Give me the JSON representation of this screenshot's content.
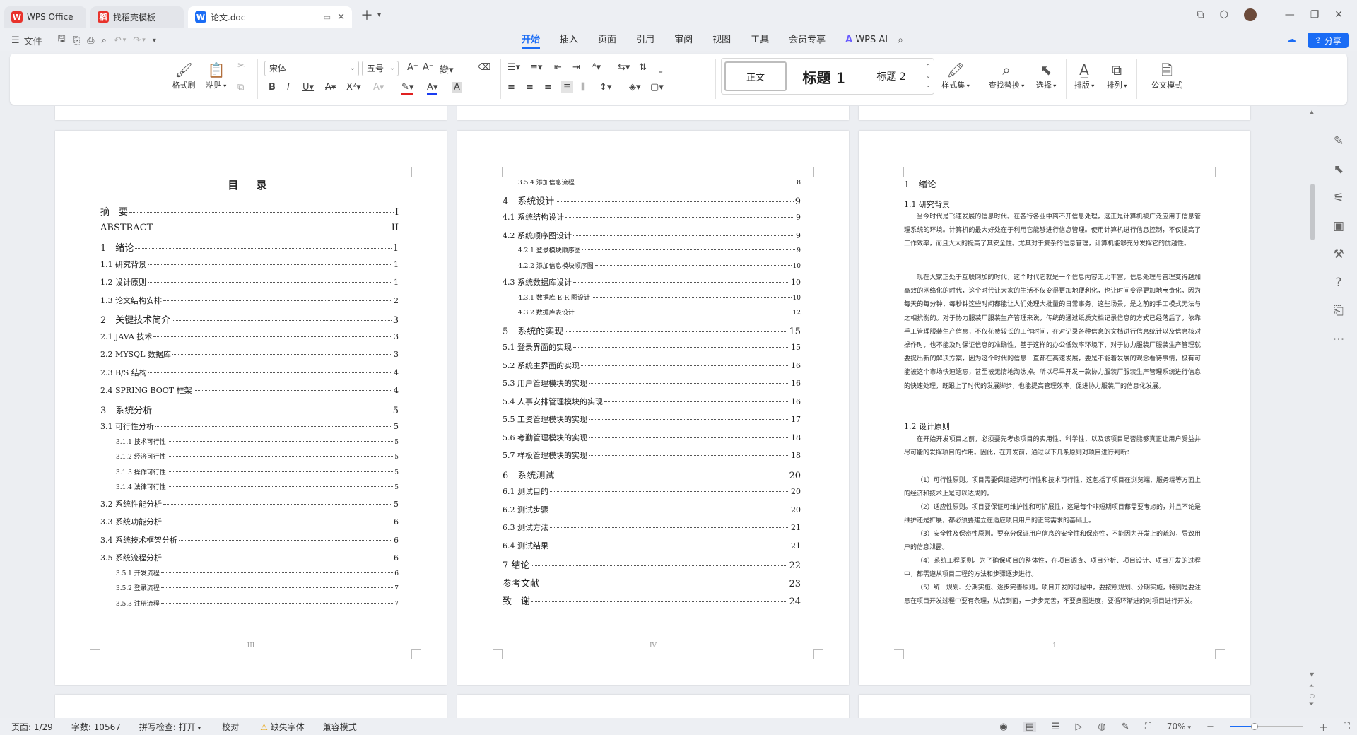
{
  "tabs": [
    {
      "logo": "W",
      "label": "WPS Office",
      "logo_color": "#e8322b"
    },
    {
      "logo": "稻",
      "label": "找稻壳模板",
      "logo_color": "#e8322b"
    },
    {
      "logo": "W",
      "label": "论文.doc",
      "logo_color": "#1a6cf5"
    }
  ],
  "menubar": {
    "file": "文件",
    "items": [
      "开始",
      "插入",
      "页面",
      "引用",
      "审阅",
      "视图",
      "工具",
      "会员专享"
    ],
    "ai": "WPS AI",
    "share": "分享"
  },
  "ribbon": {
    "format_painter": "格式刷",
    "paste": "粘贴",
    "font": "宋体",
    "size": "五号",
    "style_body": "正文",
    "style_h1": "标题 1",
    "style_h2": "标题 2",
    "style_set": "样式集",
    "find_replace": "查找替换",
    "select": "选择",
    "layout": "排版",
    "arrange": "排列",
    "official": "公文模式"
  },
  "page1": {
    "title": "目 录",
    "entries": [
      {
        "t": "摘　要",
        "p": "I",
        "lv": 1
      },
      {
        "t": "ABSTRACT",
        "p": "II",
        "lv": 1
      },
      {
        "t": "1　绪论",
        "p": "1",
        "lv": 1
      },
      {
        "t": "1.1 研究背景",
        "p": "1",
        "lv": 2
      },
      {
        "t": "1.2 设计原则",
        "p": "1",
        "lv": 2
      },
      {
        "t": "1.3 论文结构安排",
        "p": "2",
        "lv": 2
      },
      {
        "t": "2　关键技术简介",
        "p": "3",
        "lv": 1
      },
      {
        "t": "2.1 JAVA 技术",
        "p": "3",
        "lv": 2
      },
      {
        "t": "2.2 MYSQL 数据库",
        "p": "3",
        "lv": 2
      },
      {
        "t": "2.3 B/S 结构",
        "p": "4",
        "lv": 2
      },
      {
        "t": "2.4 SPRING BOOT 框架",
        "p": "4",
        "lv": 2
      },
      {
        "t": "3　系统分析",
        "p": "5",
        "lv": 1
      },
      {
        "t": "3.1 可行性分析",
        "p": "5",
        "lv": 2
      },
      {
        "t": "3.1.1 技术可行性",
        "p": "5",
        "lv": 3
      },
      {
        "t": "3.1.2 经济可行性",
        "p": "5",
        "lv": 3
      },
      {
        "t": "3.1.3 操作可行性",
        "p": "5",
        "lv": 3
      },
      {
        "t": "3.1.4 法律可行性",
        "p": "5",
        "lv": 3
      },
      {
        "t": "3.2 系统性能分析",
        "p": "5",
        "lv": 2
      },
      {
        "t": "3.3 系统功能分析",
        "p": "6",
        "lv": 2
      },
      {
        "t": "3.4 系统技术框架分析",
        "p": "6",
        "lv": 2
      },
      {
        "t": "3.5 系统流程分析",
        "p": "6",
        "lv": 2
      },
      {
        "t": "3.5.1 开发流程",
        "p": "6",
        "lv": 3
      },
      {
        "t": "3.5.2 登录流程",
        "p": "7",
        "lv": 3
      },
      {
        "t": "3.5.3 注册流程",
        "p": "7",
        "lv": 3
      }
    ],
    "footer": "III"
  },
  "page2": {
    "entries": [
      {
        "t": "3.5.4 添加信息流程",
        "p": "8",
        "lv": 3
      },
      {
        "t": "4　系统设计",
        "p": "9",
        "lv": 1
      },
      {
        "t": "4.1 系统结构设计",
        "p": "9",
        "lv": 2
      },
      {
        "t": "4.2 系统顺序图设计",
        "p": "9",
        "lv": 2
      },
      {
        "t": "4.2.1 登录模块顺序图",
        "p": "9",
        "lv": 3
      },
      {
        "t": "4.2.2 添加信息模块顺序图",
        "p": "10",
        "lv": 3
      },
      {
        "t": "4.3 系统数据库设计",
        "p": "10",
        "lv": 2
      },
      {
        "t": "4.3.1 数据库 E-R 图设计",
        "p": "10",
        "lv": 3
      },
      {
        "t": "4.3.2 数据库表设计",
        "p": "12",
        "lv": 3
      },
      {
        "t": "5　系统的实现",
        "p": "15",
        "lv": 1
      },
      {
        "t": "5.1 登录界面的实现",
        "p": "15",
        "lv": 2
      },
      {
        "t": "5.2 系统主界面的实现",
        "p": "16",
        "lv": 2
      },
      {
        "t": "5.3 用户管理模块的实现",
        "p": "16",
        "lv": 2
      },
      {
        "t": "5.4 人事安排管理模块的实现",
        "p": "16",
        "lv": 2
      },
      {
        "t": "5.5 工资管理模块的实现",
        "p": "17",
        "lv": 2
      },
      {
        "t": "5.6 考勤管理模块的实现",
        "p": "18",
        "lv": 2
      },
      {
        "t": "5.7 样板管理模块的实现",
        "p": "18",
        "lv": 2
      },
      {
        "t": "6　系统测试",
        "p": "20",
        "lv": 1
      },
      {
        "t": "6.1 测试目的",
        "p": "20",
        "lv": 2
      },
      {
        "t": "6.2 测试步骤",
        "p": "20",
        "lv": 2
      },
      {
        "t": "6.3 测试方法",
        "p": "21",
        "lv": 2
      },
      {
        "t": "6.4 测试结果",
        "p": "21",
        "lv": 2
      },
      {
        "t": "7 结论",
        "p": "22",
        "lv": 1
      },
      {
        "t": "参考文献",
        "p": "23",
        "lv": 1
      },
      {
        "t": "致　谢",
        "p": "24",
        "lv": 1
      }
    ],
    "footer": "IV"
  },
  "page3": {
    "h1": "1　绪论",
    "h2a": "1.1 研究背景",
    "p1": "当今时代是飞速发展的信息时代。在各行各业中离不开信息处理，这正是计算机被广泛应用于信息管理系统的环境。计算机的最大好处在于利用它能够进行信息管理。使用计算机进行信息控制，不仅提高了工作效率，而且大大的提高了其安全性。尤其对于复杂的信息管理，计算机能够充分发挥它的优越性。",
    "p2": "现在大家正处于互联网加的时代，这个时代它就是一个信息内容无比丰富，信息处理与管理变得越加高效的网络化的时代，这个时代让大家的生活不仅变得更加地便利化，也让时间变得更加地宝贵化，因为每天的每分钟，每秒钟这些时间都能让人们处理大批量的日常事务，这些场景，是之前的手工模式无法与之相抗衡的。对于协力服装厂服装生产管理来说，传统的通过纸质文档记录信息的方式已经落后了，依靠手工管理服装生产信息，不仅花费较长的工作时间，在对记录各种信息的文档进行信息统计以及信息核对操作时，也不能及时保证信息的准确性，基于这样的办公低效率环境下，对于协力服装厂服装生产管理就要提出新的解决方案，因为这个时代的信息一直都在高速发展，要是不能着发展的观念看待事情，极有可能被这个市场快速遗忘，甚至被无情地淘汰掉。所以尽早开发一款协力服装厂服装生产管理系统进行信息的快速处理，既跟上了时代的发展脚步，也能提高管理效率，促进协力服装厂的信息化发展。",
    "h2b": "1.2 设计原则",
    "p3": "在开始开发项目之前，必须要先考虑项目的实用性、科学性，以及该项目是否能够真正让用户受益并尽可能的发挥项目的作用。因此，在开发前，通过以下几条原则对项目进行判断：",
    "p4": "（1）可行性原则。项目需要保证经济可行性和技术可行性，这包括了项目在浏览端、服务端等方面上的经济和技术上是可以达成的。",
    "p5": "（2）适应性原则。项目要保证可维护性和可扩展性，这是每个非短期项目都需要考虑的，并且不论是维护还是扩展，都必须要建立在适应项目用户的正常需求的基础上。",
    "p6": "（3）安全性及保密性原则。要充分保证用户信息的安全性和保密性，不能因为开发上的疏忽，导致用户的信息泄露。",
    "p7": "（4）系统工程原则。为了确保项目的整体性，在项目调查、项目分析、项目设计、项目开发的过程中，都需遵从项目工程的方法和步骤逐步进行。",
    "p8": "（5）统一规划、分期实施、逐步完善原则。项目开发的过程中，要按照规划、分期实施，特别是要注意在项目开发过程中要有条理，从点到面，一步步完善，不要贪图进度，要循环渐进的对项目进行开发。",
    "footer": "1"
  },
  "status": {
    "page": "页面: 1/29",
    "words": "字数: 10567",
    "spell": "拼写检查: 打开",
    "proof": "校对",
    "missing_font": "缺失字体",
    "compat": "兼容模式",
    "zoom": "70%"
  }
}
